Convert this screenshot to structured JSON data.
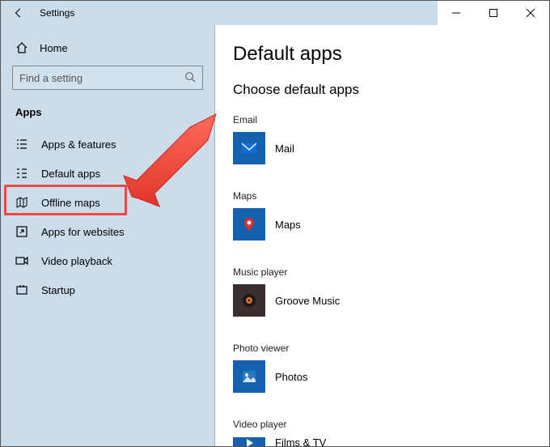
{
  "window": {
    "title": "Settings"
  },
  "sidebar": {
    "home_label": "Home",
    "search_placeholder": "Find a setting",
    "section": "Apps",
    "items": [
      {
        "label": "Apps & features"
      },
      {
        "label": "Default apps"
      },
      {
        "label": "Offline maps"
      },
      {
        "label": "Apps for websites"
      },
      {
        "label": "Video playback"
      },
      {
        "label": "Startup"
      }
    ]
  },
  "content": {
    "heading": "Default apps",
    "subheading": "Choose default apps",
    "categories": [
      {
        "label": "Email",
        "app": "Mail"
      },
      {
        "label": "Maps",
        "app": "Maps"
      },
      {
        "label": "Music player",
        "app": "Groove Music"
      },
      {
        "label": "Photo viewer",
        "app": "Photos"
      },
      {
        "label": "Video player",
        "app": "Films & TV"
      }
    ]
  },
  "annotation": {
    "highlight": "Default apps nav item highlighted with red box and arrow"
  }
}
